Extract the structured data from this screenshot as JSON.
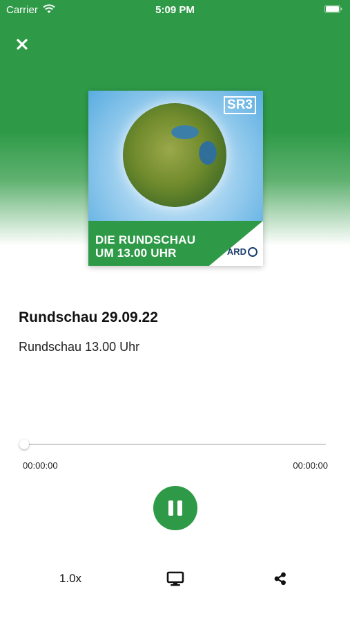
{
  "status_bar": {
    "carrier": "Carrier",
    "time": "5:09 PM"
  },
  "icons": {
    "close": "close-icon",
    "wifi": "wifi-icon",
    "battery": "battery-icon",
    "pause": "pause-icon",
    "airplay": "monitor-icon",
    "share": "share-icon"
  },
  "cover": {
    "logo_text": "SR3",
    "title_line1": "DIE RUNDSCHAU",
    "title_line2": "UM 13.00 UHR",
    "brand_text": "ARD"
  },
  "episode": {
    "title": "Rundschau 29.09.22",
    "subtitle": "Rundschau 13.00 Uhr"
  },
  "player": {
    "elapsed": "00:00:00",
    "total": "00:00:00",
    "progress": 0,
    "speed_label": "1.0x",
    "state": "playing"
  },
  "colors": {
    "brand_green": "#2e9a47",
    "track": "#d0d0d0"
  }
}
